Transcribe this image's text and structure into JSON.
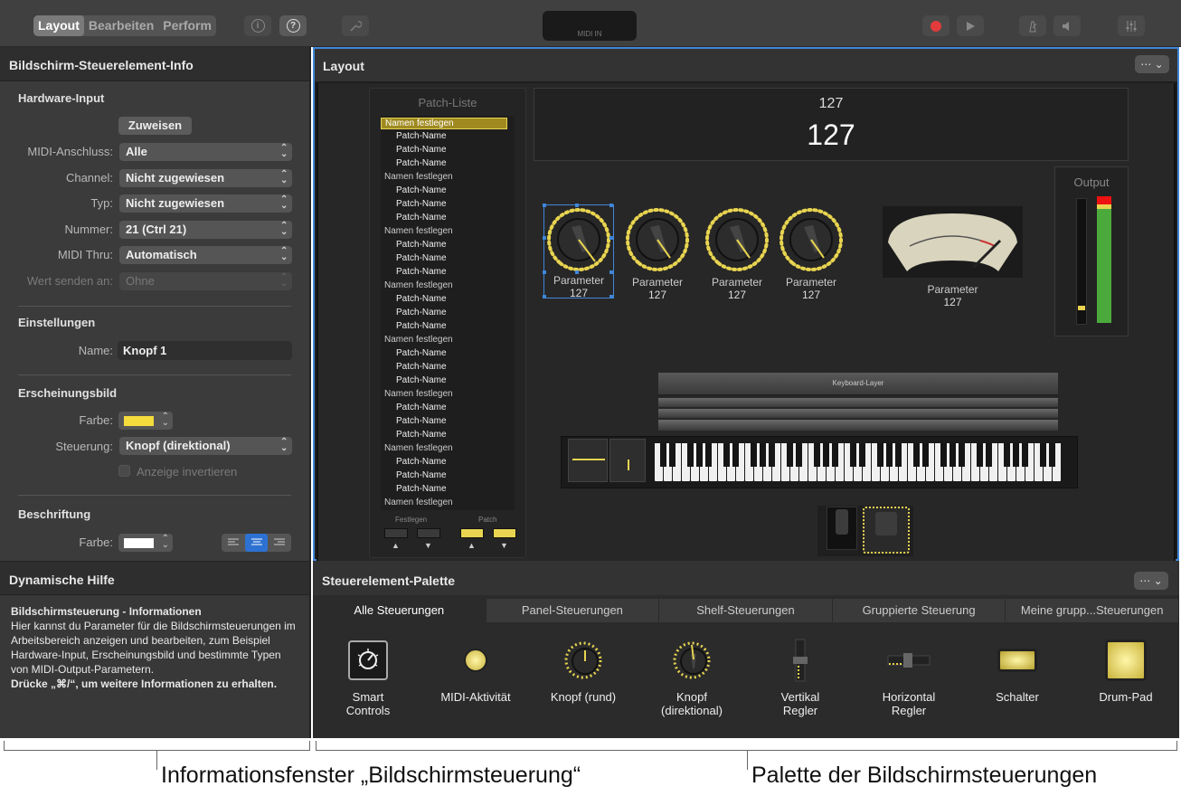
{
  "toolbar": {
    "modes": [
      "Layout",
      "Bearbeiten",
      "Perform"
    ],
    "active_mode": "Layout",
    "midi_in_label": "MIDI IN"
  },
  "inspector": {
    "title": "Bildschirm-Steuerelement-Info",
    "hardware_input": {
      "section": "Hardware-Input",
      "assign_button": "Zuweisen",
      "rows": [
        {
          "label": "MIDI-Anschluss:",
          "value": "Alle"
        },
        {
          "label": "Channel:",
          "value": "Nicht zugewiesen"
        },
        {
          "label": "Typ:",
          "value": "Nicht zugewiesen"
        },
        {
          "label": "Nummer:",
          "value": "21 (Ctrl 21)"
        },
        {
          "label": "MIDI Thru:",
          "value": "Automatisch"
        },
        {
          "label": "Wert senden an:",
          "value": "Ohne"
        }
      ]
    },
    "settings": {
      "section": "Einstellungen",
      "name_label": "Name:",
      "name_value": "Knopf 1"
    },
    "appearance": {
      "section": "Erscheinungsbild",
      "color_label": "Farbe:",
      "color": "#f5dc3c",
      "control_label": "Steuerung:",
      "control_value": "Knopf (direktional)",
      "invert_label": "Anzeige invertieren"
    },
    "caption": {
      "section": "Beschriftung",
      "color_label": "Farbe:",
      "color": "#ffffff"
    }
  },
  "help": {
    "title": "Dynamische Hilfe",
    "heading": "Bildschirmsteuerung - Informationen",
    "body": "Hier kannst du Parameter für die Bildschirmsteuerungen im Arbeitsbereich anzeigen und bearbeiten, zum Beispiel Hardware-Input, Erscheinungsbild und bestimmte Typen von MIDI-Output-Parametern.",
    "shortcut": "Drücke „⌘/“, um weitere Informationen zu erhalten."
  },
  "layout": {
    "title": "Layout",
    "patch_list": {
      "title": "Patch-Liste",
      "groups": [
        {
          "header": "Namen festlegen",
          "items": [
            "Patch-Name",
            "Patch-Name",
            "Patch-Name"
          ]
        },
        {
          "header": "Namen festlegen",
          "items": [
            "Patch-Name",
            "Patch-Name",
            "Patch-Name"
          ]
        },
        {
          "header": "Namen festlegen",
          "items": [
            "Patch-Name",
            "Patch-Name",
            "Patch-Name"
          ]
        },
        {
          "header": "Namen festlegen",
          "items": [
            "Patch-Name",
            "Patch-Name",
            "Patch-Name"
          ]
        },
        {
          "header": "Namen festlegen",
          "items": [
            "Patch-Name",
            "Patch-Name",
            "Patch-Name"
          ]
        },
        {
          "header": "Namen festlegen",
          "items": [
            "Patch-Name",
            "Patch-Name",
            "Patch-Name"
          ]
        },
        {
          "header": "Namen festlegen",
          "items": [
            "Patch-Name",
            "Patch-Name",
            "Patch-Name"
          ]
        },
        {
          "header": "Namen festlegen",
          "items": []
        }
      ],
      "footer_left": "Festlegen",
      "footer_right": "Patch"
    },
    "display": {
      "small": "127",
      "large": "127"
    },
    "knobs": [
      {
        "label": "Parameter",
        "value": "127"
      },
      {
        "label": "Parameter",
        "value": "127"
      },
      {
        "label": "Parameter",
        "value": "127"
      },
      {
        "label": "Parameter",
        "value": "127"
      }
    ],
    "meter": {
      "label": "Parameter",
      "value": "127"
    },
    "output_label": "Output",
    "keyboard_layer": "Keyboard-Layer"
  },
  "palette": {
    "title": "Steuerelement-Palette",
    "tabs": [
      "Alle Steuerungen",
      "Panel-Steuerungen",
      "Shelf-Steuerungen",
      "Gruppierte Steuerung",
      "Meine grupp...Steuerungen"
    ],
    "items": [
      {
        "label": "Smart\nControls",
        "icon": "smart-controls-icon"
      },
      {
        "label": "MIDI-Aktivität",
        "icon": "midi-activity-icon"
      },
      {
        "label": "Knopf (rund)",
        "icon": "knob-round-icon"
      },
      {
        "label": "Knopf\n(direktional)",
        "icon": "knob-directional-icon"
      },
      {
        "label": "Vertikal\nRegler",
        "icon": "vertical-slider-icon"
      },
      {
        "label": "Horizontal\nRegler",
        "icon": "horizontal-slider-icon"
      },
      {
        "label": "Schalter",
        "icon": "switch-icon"
      },
      {
        "label": "Drum-Pad",
        "icon": "drum-pad-icon"
      }
    ]
  },
  "annotations": {
    "left": "Informationsfenster „Bildschirmsteuerung“",
    "right": "Palette der Bildschirmsteuerungen"
  }
}
